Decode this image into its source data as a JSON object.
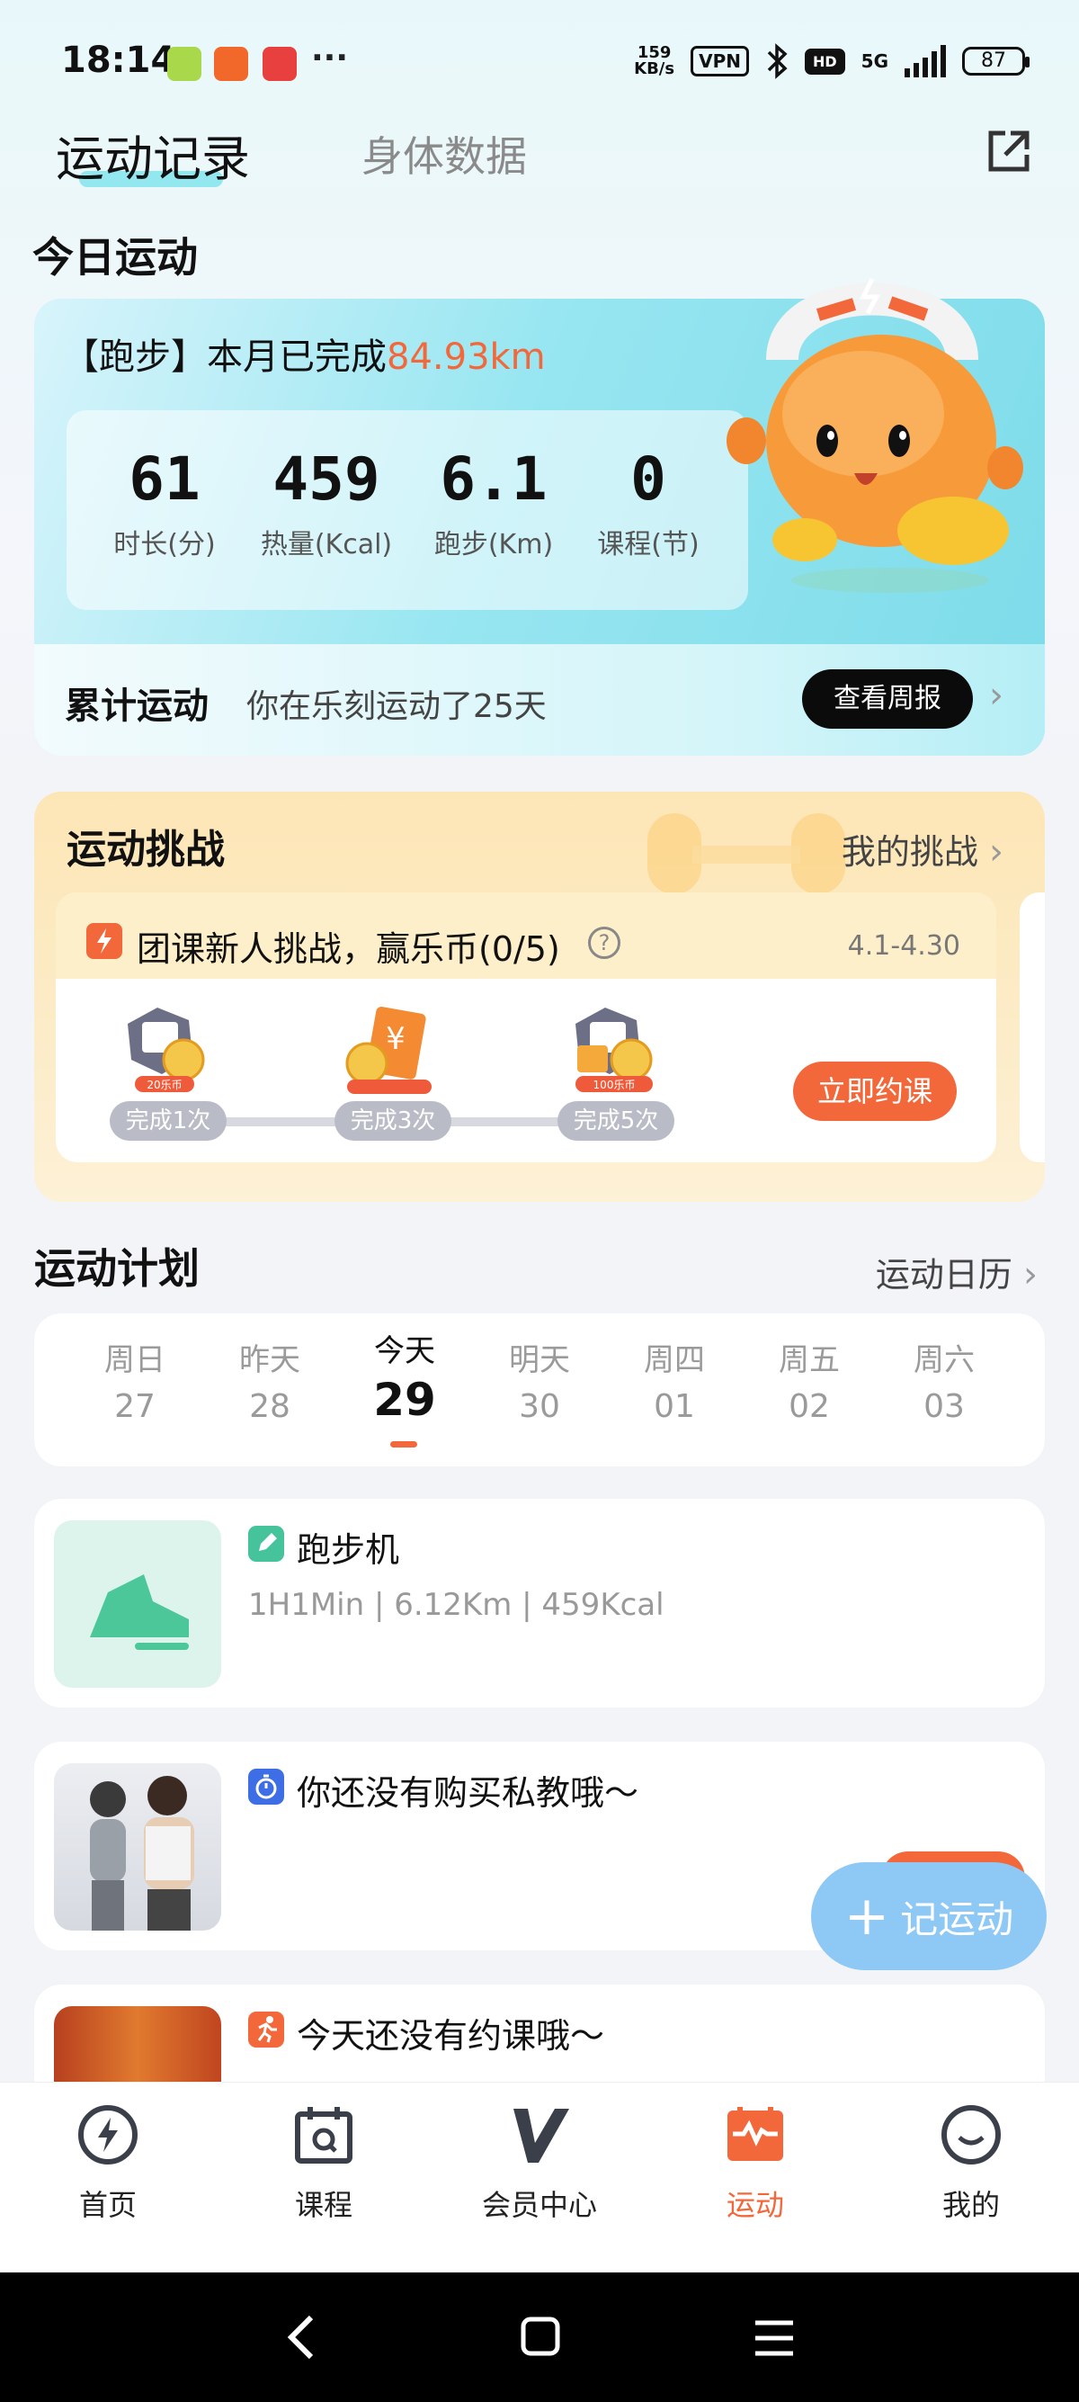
{
  "status_bar": {
    "time": "18:14",
    "more": "···",
    "speed_value": "159",
    "speed_unit": "KB/s",
    "vpn": "VPN",
    "hd": "HD",
    "network": "5G",
    "battery": "87"
  },
  "tabs": [
    {
      "label": "运动记录"
    },
    {
      "label": "身体数据"
    }
  ],
  "today": {
    "section_title": "今日运动",
    "run_prefix": "【跑步】本月已完成",
    "run_value": "84.93km",
    "stats": [
      {
        "value": "61",
        "label": "时长(分)"
      },
      {
        "value": "459",
        "label": "热量(Kcal)"
      },
      {
        "value": "6.1",
        "label": "跑步(Km)"
      },
      {
        "value": "0",
        "label": "课程(节)"
      }
    ],
    "cumulative_title": "累计运动",
    "cumulative_text": "你在乐刻运动了25天",
    "weekly_button": "查看周报"
  },
  "challenge": {
    "title": "运动挑战",
    "my_link": "我的挑战",
    "name": "团课新人挑战，赢乐币(0/5)",
    "date": "4.1-4.30",
    "milestones": [
      {
        "label": "完成1次",
        "reward": "20乐币"
      },
      {
        "label": "完成3次",
        "reward": ""
      },
      {
        "label": "完成5次",
        "reward": "100乐币"
      }
    ],
    "book_button": "立即约课"
  },
  "plan": {
    "title": "运动计划",
    "calendar_link": "运动日历",
    "days": [
      {
        "name": "周日",
        "date": "27"
      },
      {
        "name": "昨天",
        "date": "28"
      },
      {
        "name": "今天",
        "date": "29"
      },
      {
        "name": "明天",
        "date": "30"
      },
      {
        "name": "周四",
        "date": "01"
      },
      {
        "name": "周五",
        "date": "02"
      },
      {
        "name": "周六",
        "date": "03"
      }
    ],
    "items": [
      {
        "title": "跑步机",
        "subtitle": "1H1Min | 6.12Km | 459Kcal"
      },
      {
        "title": "你还没有购买私教哦～"
      },
      {
        "title": "今天还没有约课哦～"
      }
    ]
  },
  "fab": {
    "label": "记运动"
  },
  "nav": [
    {
      "label": "首页"
    },
    {
      "label": "课程"
    },
    {
      "label": "会员中心"
    },
    {
      "label": "运动"
    },
    {
      "label": "我的"
    }
  ],
  "colors": {
    "accent": "#f2683b",
    "teal": "#7ddbe9",
    "fab": "#8ec8f4"
  }
}
